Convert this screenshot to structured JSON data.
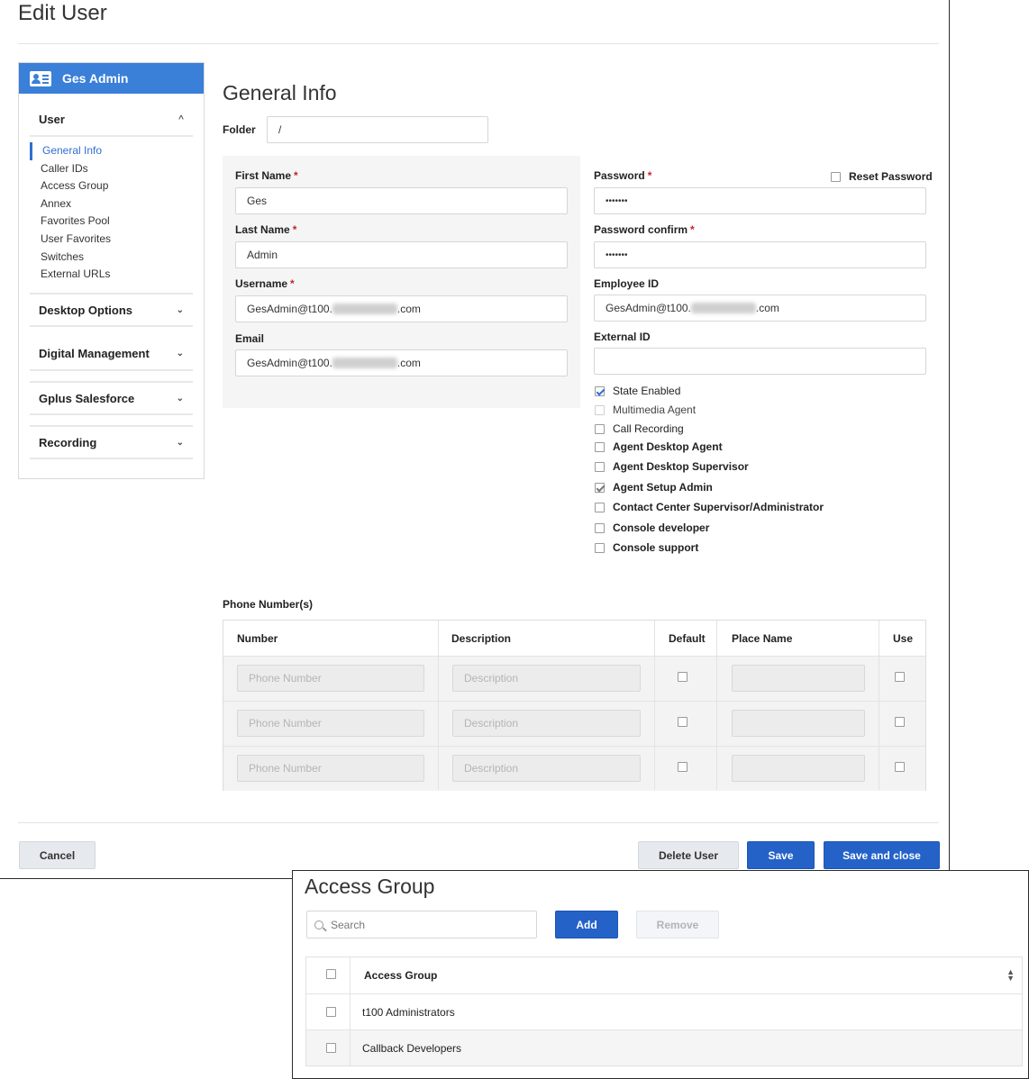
{
  "window": {
    "title": "Edit User"
  },
  "sidebar": {
    "header": "Ges Admin",
    "sections": [
      {
        "label": "User",
        "expanded": true
      },
      {
        "label": "Desktop Options",
        "expanded": false
      },
      {
        "label": "Digital Management",
        "expanded": false
      },
      {
        "label": "Gplus Salesforce",
        "expanded": false
      },
      {
        "label": "Recording",
        "expanded": false
      }
    ],
    "items": [
      "General Info",
      "Caller IDs",
      "Access Group",
      "Annex",
      "Favorites Pool",
      "User Favorites",
      "Switches",
      "External URLs"
    ],
    "active_item": "General Info"
  },
  "general": {
    "title": "General Info",
    "folder_label": "Folder",
    "folder_value": "/",
    "first_name_label": "First Name",
    "first_name_value": "Ges",
    "last_name_label": "Last Name",
    "last_name_value": "Admin",
    "username_label": "Username",
    "username_prefix": "GesAdmin@t100.",
    "username_suffix": ".com",
    "email_label": "Email",
    "email_prefix": "GesAdmin@t100.",
    "email_suffix": ".com",
    "password_label": "Password",
    "password_value": "•••••••",
    "reset_password_label": "Reset Password",
    "password_confirm_label": "Password confirm",
    "password_confirm_value": "•••••••",
    "employee_id_label": "Employee ID",
    "employee_id_prefix": "GesAdmin@t100.",
    "employee_id_suffix": ".com",
    "external_id_label": "External ID",
    "external_id_value": "",
    "required_mark": "*"
  },
  "checks": [
    {
      "label": "State Enabled",
      "checked": true
    },
    {
      "label": "Multimedia Agent",
      "checked": false
    },
    {
      "label": "Call Recording",
      "checked": false
    },
    {
      "label": "Agent Desktop Agent",
      "checked": false
    },
    {
      "label": "Agent Desktop Supervisor",
      "checked": false
    },
    {
      "label": "Agent Setup Admin",
      "checked": true
    },
    {
      "label": "Contact Center Supervisor/Administrator",
      "checked": false
    },
    {
      "label": "Console developer",
      "checked": false
    },
    {
      "label": "Console support",
      "checked": false
    }
  ],
  "phones": {
    "title": "Phone Number(s)",
    "columns": [
      "Number",
      "Description",
      "Default",
      "Place Name",
      "Use"
    ],
    "number_placeholder": "Phone Number",
    "description_placeholder": "Description"
  },
  "buttons": {
    "cancel": "Cancel",
    "delete_user": "Delete User",
    "save": "Save",
    "save_close": "Save and close"
  },
  "access_group": {
    "title": "Access Group",
    "search_placeholder": "Search",
    "add": "Add",
    "remove": "Remove",
    "column": "Access Group",
    "rows": [
      "t100 Administrators",
      "Callback Developers"
    ]
  },
  "colors": {
    "accent": "#2462c8",
    "sidebar_header": "#3a7fd8",
    "required": "#c0262d"
  }
}
